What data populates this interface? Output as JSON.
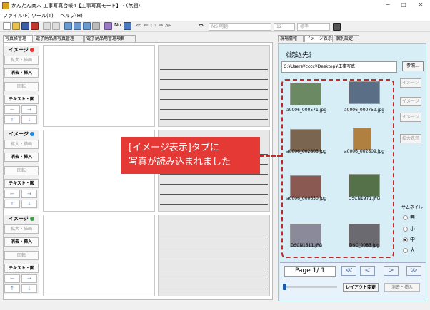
{
  "window": {
    "title": "かんたん商人 工事写真台帳4【工事写真モード】 - (無題)",
    "minimize": "−",
    "maximize": "□",
    "close": "✕"
  },
  "menu": [
    "ファイル(F)",
    "ツール(T)",
    "ヘルプ(H)"
  ],
  "toolbar": {
    "no_label": "No.",
    "font_name": "MS 明朝",
    "font_size": "12",
    "font_style": "標準"
  },
  "left_tabs": [
    "写真帳管理",
    "電子納品用写真管理",
    "電子納品用管理項目"
  ],
  "slots": [
    {
      "label": "イメージ",
      "dot_color": "#e53935",
      "buttons": [
        "拡大・描画",
        "消去・挿入",
        "回転",
        "テキスト・図"
      ]
    },
    {
      "label": "イメージ",
      "dot_color": "#1e88e5",
      "buttons": [
        "拡大・描画",
        "消去・挿入",
        "回転",
        "テキスト・図"
      ]
    },
    {
      "label": "イメージ",
      "dot_color": "#43a047",
      "buttons": [
        "拡大・描画",
        "消去・挿入",
        "回転",
        "テキスト・図"
      ]
    }
  ],
  "arrows": {
    "left": "←",
    "right": "→",
    "up": "↑",
    "down": "↓"
  },
  "right_tabs": [
    "現場情報",
    "イメージ表示",
    "個別設定"
  ],
  "panel": {
    "source_label": "《読込先》",
    "path": "C:¥Users¥cccc¥Desktop¥工事写真",
    "browse": "参照...",
    "photos": [
      {
        "name": "a0006_000571.jpg",
        "color": "#6b8a63"
      },
      {
        "name": "a0006_000759.jpg",
        "color": "#5a6f86"
      },
      {
        "name": "a0006_002803.jpg",
        "color": "#7a6650"
      },
      {
        "name": "a0006_002809.jpg",
        "color": "#b08040"
      },
      {
        "name": "a0006_000650.jpg",
        "color": "#8a5a52"
      },
      {
        "name": "DSCN1971.JPG",
        "color": "#55714a"
      },
      {
        "name": "DSCN1511.JPG",
        "color": "#8a8a9a"
      },
      {
        "name": "DSC_0083.jpg",
        "color": "#6a6a70"
      }
    ],
    "image_buttons": [
      "イメージ",
      "イメージ",
      "イメージ"
    ],
    "enlarge": "拡大表示",
    "thumb_label": "サムネイル",
    "thumb_sizes": [
      "無",
      "小",
      "中",
      "大"
    ],
    "thumb_selected": "中",
    "page": "Page 1/ 1",
    "nav": [
      "≪",
      "<",
      ">",
      "≫"
    ],
    "layout_change": "レイアウト変更",
    "erase_insert": "消去・挿入"
  },
  "callout": {
    "line1": "[イメージ表示]タブに",
    "line2": "写真が読み込まれました"
  }
}
